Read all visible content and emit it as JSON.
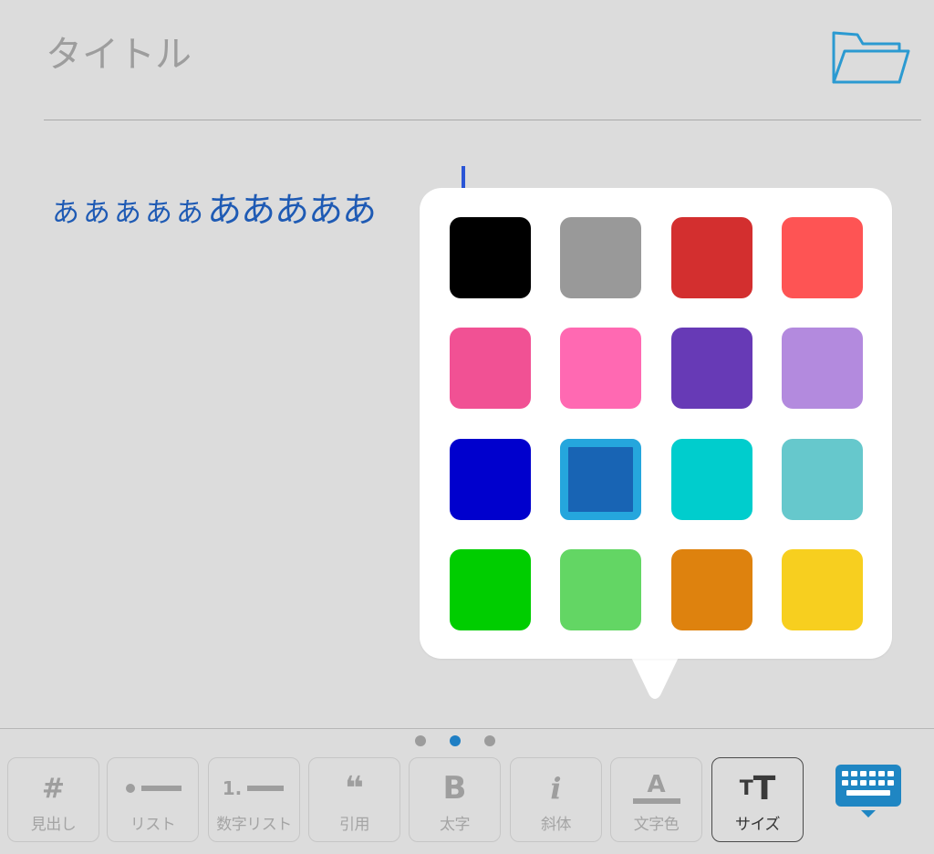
{
  "title": {
    "placeholder": "タイトル"
  },
  "editor": {
    "text_small": "あああああ",
    "text_large": "あああああ"
  },
  "color_picker": {
    "swatches": [
      {
        "name": "black",
        "color": "#000000"
      },
      {
        "name": "gray",
        "color": "#999999"
      },
      {
        "name": "red",
        "color": "#d32f2f"
      },
      {
        "name": "light-red",
        "color": "#fe5454"
      },
      {
        "name": "dark-pink",
        "color": "#f15194"
      },
      {
        "name": "pink",
        "color": "#ff69b2"
      },
      {
        "name": "purple",
        "color": "#673ab6"
      },
      {
        "name": "lavender",
        "color": "#b38ade"
      },
      {
        "name": "blue",
        "color": "#0000cd"
      },
      {
        "name": "medium-blue",
        "color": "#1864b4",
        "selected": true
      },
      {
        "name": "cyan",
        "color": "#00cdcd"
      },
      {
        "name": "teal",
        "color": "#66c8cc"
      },
      {
        "name": "green",
        "color": "#00cd00"
      },
      {
        "name": "light-green",
        "color": "#63d664"
      },
      {
        "name": "orange",
        "color": "#de820e"
      },
      {
        "name": "yellow",
        "color": "#f7cf1f"
      }
    ],
    "selected_border_color": "#25a6dd"
  },
  "toolbar": {
    "page_index": 1,
    "page_count": 3,
    "buttons": [
      {
        "id": "heading",
        "icon": "hash-icon",
        "glyph": "#",
        "label": "見出し"
      },
      {
        "id": "list",
        "icon": "bullet-list-icon",
        "glyph": "",
        "label": "リスト"
      },
      {
        "id": "numbered-list",
        "icon": "numbered-list-icon",
        "glyph": "1.",
        "label": "数字リスト"
      },
      {
        "id": "quote",
        "icon": "quote-icon",
        "glyph": "❝",
        "label": "引用"
      },
      {
        "id": "bold",
        "icon": "bold-icon",
        "glyph": "B",
        "label": "太字"
      },
      {
        "id": "italic",
        "icon": "italic-icon",
        "glyph": "i",
        "label": "斜体"
      },
      {
        "id": "text-color",
        "icon": "text-color-icon",
        "glyph": "A",
        "label": "文字色"
      },
      {
        "id": "size",
        "icon": "text-size-icon",
        "glyph": "TT",
        "label": "サイズ",
        "active": true
      }
    ]
  },
  "colors": {
    "accent": "#1f7fc4",
    "folder_icon": "#2b9ad1",
    "keyboard_icon": "#1f86c3",
    "body_text": "#1e5ab4"
  }
}
